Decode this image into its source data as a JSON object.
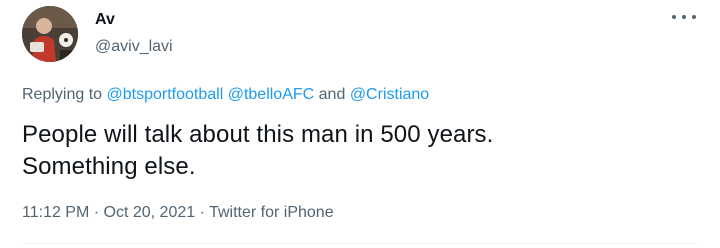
{
  "author": {
    "display_name": "Av",
    "handle": "@aviv_lavi"
  },
  "reply": {
    "prefix": "Replying to",
    "mentions": [
      "@btsportfootball",
      "@tbelloAFC",
      "@Cristiano"
    ],
    "conjunction": "and"
  },
  "tweet": {
    "lines": [
      "People will talk about this man in 500 years.",
      "Something else."
    ]
  },
  "meta": {
    "time": "11:12 PM",
    "separator": "·",
    "date": "Oct 20, 2021",
    "source": "Twitter for iPhone"
  },
  "icons": {
    "more": "more-options-icon"
  },
  "colors": {
    "text": "#0f1419",
    "secondary": "#536471",
    "link": "#1d9bf0"
  }
}
